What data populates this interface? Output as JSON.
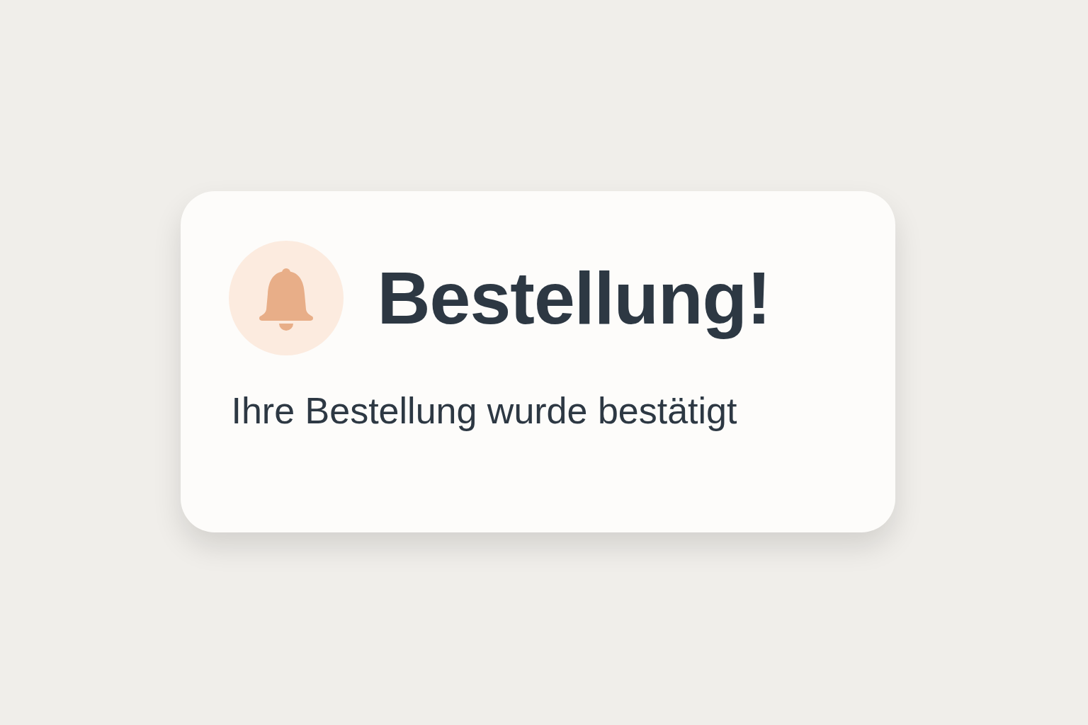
{
  "notification": {
    "title": "Bestellung!",
    "message": "Ihre Bestellung wurde bestätigt"
  }
}
